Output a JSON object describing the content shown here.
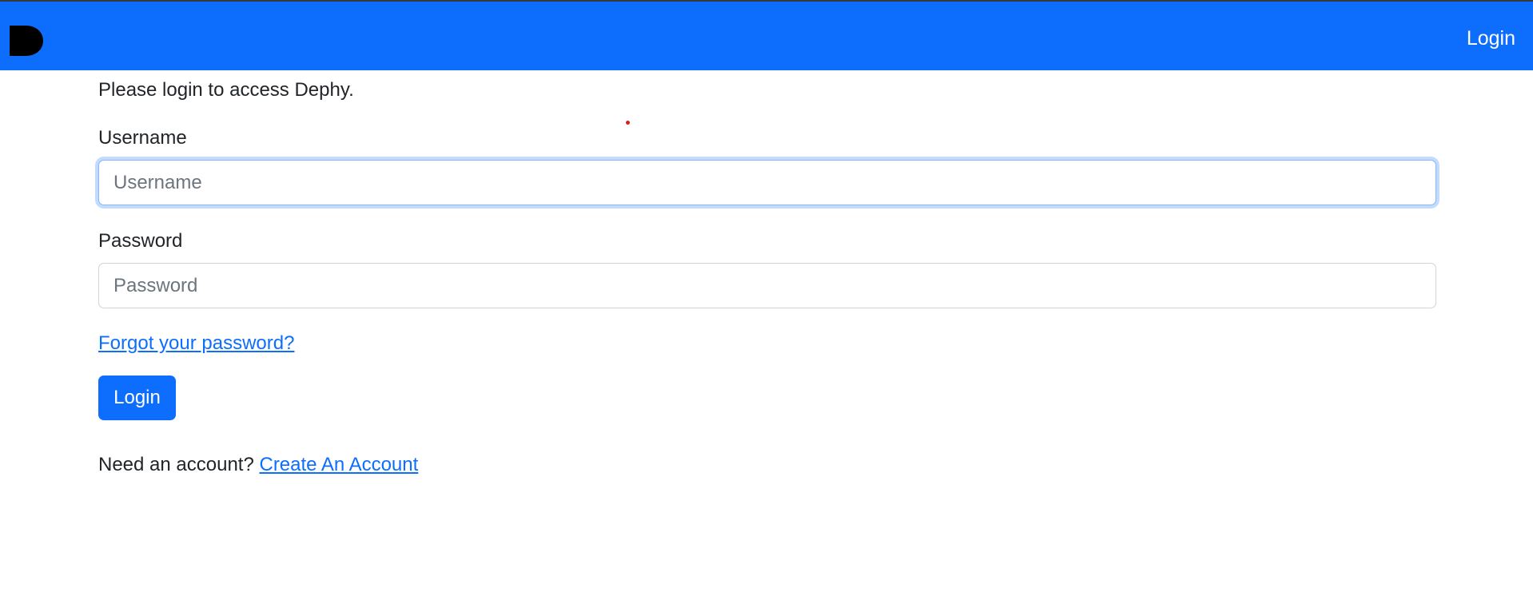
{
  "navbar": {
    "logo_icon": "dephy-d-logo",
    "login_link": "Login",
    "background_color": "#0d6efd"
  },
  "form": {
    "intro_text": "Please login to access Dephy.",
    "username_label": "Username",
    "username_placeholder": "Username",
    "username_value": "",
    "password_label": "Password",
    "password_placeholder": "Password",
    "password_value": "",
    "forgot_link": "Forgot your password?",
    "submit_label": "Login",
    "signup_prompt": "Need an account?",
    "signup_link": "Create An Account"
  },
  "colors": {
    "accent": "#0d6efd",
    "text": "#212529",
    "placeholder": "#6c757d",
    "border": "#ced4da"
  }
}
